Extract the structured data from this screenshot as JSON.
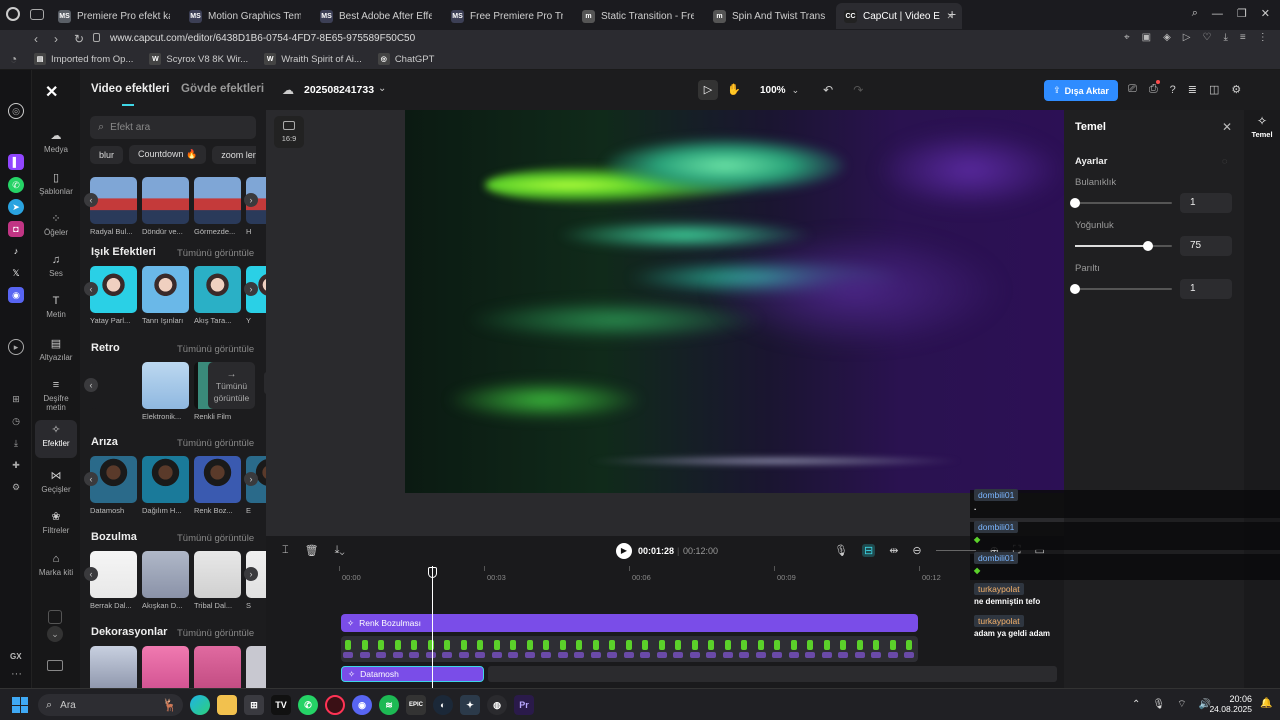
{
  "browser": {
    "tabs": [
      {
        "label": "Premiere Pro efekt kaynak",
        "favicon": "MS",
        "color": "#5a5f66"
      },
      {
        "label": "Motion Graphics Template",
        "favicon": "MS",
        "color": "#3c3f55"
      },
      {
        "label": "Best Adobe After Effects",
        "favicon": "MS",
        "color": "#3c3f55"
      },
      {
        "label": "Free Premiere Pro Transit",
        "favicon": "MS",
        "color": "#3c3f55"
      },
      {
        "label": "Static Transition - Free Pr",
        "favicon": "m",
        "color": "#555"
      },
      {
        "label": "Spin And Twist Transition",
        "favicon": "m",
        "color": "#555"
      },
      {
        "label": "CapCut | Video Editor | A",
        "favicon": "CC",
        "color": "#222",
        "active": true
      }
    ],
    "url": "www.capcut.com/editor/6438D1B6-0754-4FD7-8E65-975589F50C50",
    "bookmarks": [
      {
        "label": "Imported from Op...",
        "icon": "folder-icon"
      },
      {
        "label": "Scyrox V8 8K Wir...",
        "icon": "W"
      },
      {
        "label": "Wraith Spirit of Ai...",
        "icon": "W"
      },
      {
        "label": "ChatGPT",
        "icon": "chatgpt-icon"
      }
    ]
  },
  "nav": {
    "items": [
      {
        "label": "Medya",
        "icon": "cloud-upload-icon"
      },
      {
        "label": "Şablonlar",
        "icon": "template-icon"
      },
      {
        "label": "Öğeler",
        "icon": "elements-icon"
      },
      {
        "label": "Ses",
        "icon": "music-icon"
      },
      {
        "label": "Metin",
        "icon": "text-icon"
      },
      {
        "label": "Altyazılar",
        "icon": "captions-icon"
      },
      {
        "label": "Deşifre metin",
        "icon": "transcript-icon"
      },
      {
        "label": "Efektler",
        "icon": "effects-icon",
        "active": true
      },
      {
        "label": "Geçişler",
        "icon": "transitions-icon"
      },
      {
        "label": "Filtreler",
        "icon": "filters-icon"
      },
      {
        "label": "Marka kiti",
        "icon": "brand-kit-icon"
      }
    ]
  },
  "panel": {
    "tab_video": "Video efektleri",
    "tab_body": "Gövde efektleri",
    "search_placeholder": "Efekt ara",
    "chips": [
      "blur",
      "Countdown 🔥",
      "zoom lens"
    ],
    "see_all": "Tümünü görüntüle",
    "top_items": [
      "Radyal Bul...",
      "Döndür ve...",
      "Görmezde...",
      "H"
    ],
    "sections": [
      {
        "title": "Işık Efektleri",
        "items": [
          "Yatay Parl...",
          "Tanrı Işınları",
          "Akış Tara...",
          "Y"
        ]
      },
      {
        "title": "Retro",
        "items": [
          "",
          "Elektronik...",
          "Renkli Film"
        ],
        "more": "Tümünü görüntüle"
      },
      {
        "title": "Arıza",
        "items": [
          "Datamosh",
          "Dağılım H...",
          "Renk Boz...",
          "E"
        ]
      },
      {
        "title": "Bozulma",
        "items": [
          "Berrak Dal...",
          "Akışkan D...",
          "Tribal Dal...",
          "S"
        ]
      },
      {
        "title": "Dekorasyonlar",
        "items": [
          "",
          "",
          "",
          ""
        ]
      }
    ]
  },
  "topbar": {
    "project": "202508241733",
    "zoom": "100%",
    "export": "Dışa Aktar",
    "aspect": "16:9"
  },
  "rpanel": {
    "title": "Temel",
    "settings": "Ayarlar",
    "tab": "Temel",
    "sliders": [
      {
        "label": "Bulanıklık",
        "value": "1",
        "level": 0.0
      },
      {
        "label": "Yoğunluk",
        "value": "75",
        "level": 0.75
      },
      {
        "label": "Parıltı",
        "value": "1",
        "level": 0.0
      }
    ]
  },
  "timeline": {
    "current": "00:01:28",
    "total": "00:12:00",
    "ticks": [
      "00:00",
      "00:03",
      "00:06",
      "00:09",
      "00:12"
    ],
    "effect_clip": "Renk Bozulması",
    "clip2": "Datamosh"
  },
  "chat": [
    {
      "user": "dombili01",
      "msg": ".",
      "color": "blue"
    },
    {
      "user": "dombili01",
      "msg": "",
      "color": "blue"
    },
    {
      "user": "dombili01",
      "msg": "",
      "color": "blue"
    },
    {
      "user": "turkaypolat",
      "msg": "ne demniştin tefo",
      "color": "orange"
    },
    {
      "user": "turkaypolat",
      "msg": "adam ya geldi adam",
      "color": "orange"
    }
  ],
  "taskbar": {
    "search": "Ara",
    "time": "20:06",
    "date": "24.08.2025"
  },
  "colors": {
    "accent": "#7b5cff",
    "export_btn": "#2f8cff",
    "clip_purple": "#7a4de8"
  }
}
